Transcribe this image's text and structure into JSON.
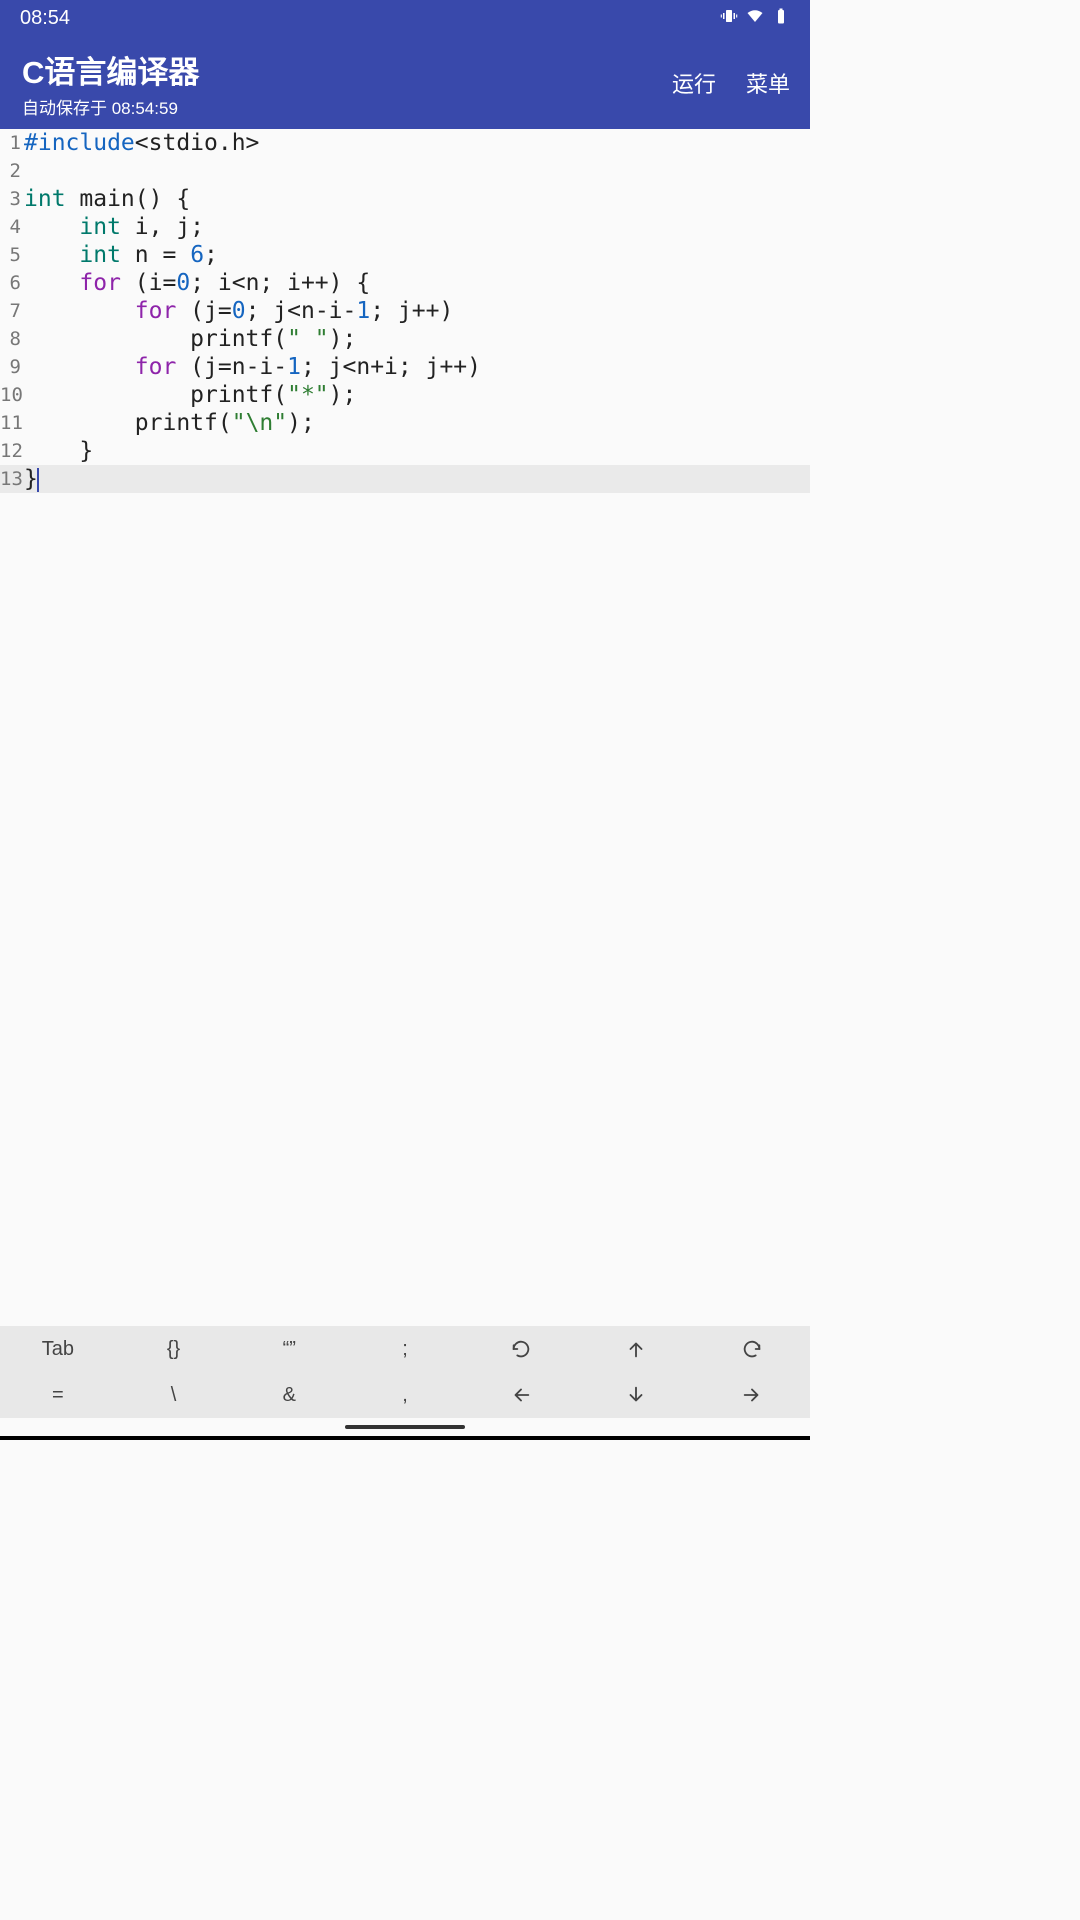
{
  "statusbar": {
    "time": "08:54"
  },
  "appbar": {
    "title": "C语言编译器",
    "subtitle": "自动保存于 08:54:59",
    "run": "运行",
    "menu": "菜单"
  },
  "code_lines": [
    1,
    2,
    3,
    4,
    5,
    6,
    7,
    8,
    9,
    10,
    11,
    12,
    13
  ],
  "code": {
    "l1_include": "#include",
    "l1_header": "<stdio.h>",
    "l3_int": "int",
    "l3_rest": " main() {",
    "l4_pad": "    ",
    "l4_int": "int",
    "l4_rest": " i, j;",
    "l5_pad": "    ",
    "l5_int": "int",
    "l5_rest1": " n = ",
    "l5_num": "6",
    "l5_rest2": ";",
    "l6_pad": "    ",
    "l6_for": "for",
    "l6_rest1": " (i=",
    "l6_n1": "0",
    "l6_rest2": "; i<n; i++) {",
    "l7_pad": "        ",
    "l7_for": "for",
    "l7_rest1": " (j=",
    "l7_n1": "0",
    "l7_rest2": "; j<n-i-",
    "l7_n2": "1",
    "l7_rest3": "; j++)",
    "l8_pad": "            printf(",
    "l8_str": "\" \"",
    "l8_rest": ");",
    "l9_pad": "        ",
    "l9_for": "for",
    "l9_rest1": " (j=n-i-",
    "l9_n1": "1",
    "l9_rest2": "; j<n+i; j++)",
    "l10_pad": "            printf(",
    "l10_str": "\"*\"",
    "l10_rest": ");",
    "l11_pad": "        printf(",
    "l11_str": "\"\\n\"",
    "l11_rest": ");",
    "l12": "    }",
    "l13": "}"
  },
  "toolbar": {
    "r1": [
      "Tab",
      "{}",
      "“”",
      ";",
      "↻",
      "⇧",
      "↺"
    ],
    "r2": [
      "=",
      "\\",
      "&",
      ",",
      "⇦",
      "⇩",
      "⇨"
    ]
  }
}
